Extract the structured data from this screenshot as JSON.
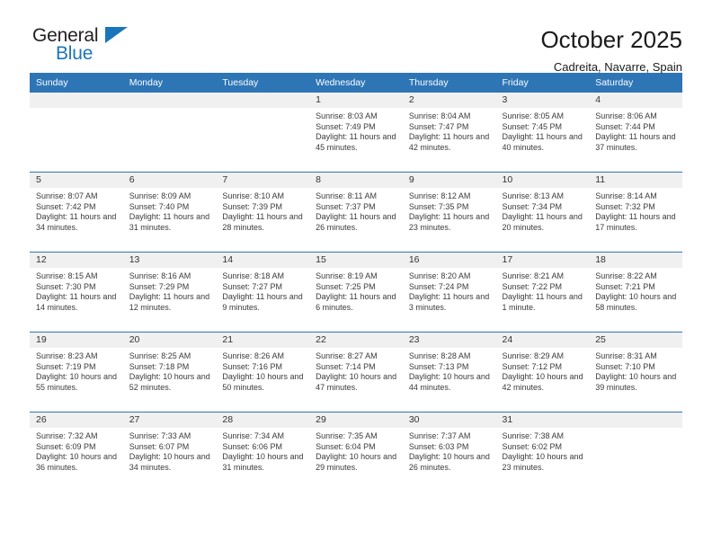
{
  "brand": {
    "name_top": "General",
    "name_bottom": "Blue",
    "accent_color": "#1b75bb",
    "triangle_icon": "triangle-icon"
  },
  "header": {
    "title": "October 2025",
    "subtitle": "Cadreita, Navarre, Spain"
  },
  "calendar": {
    "header_bg": "#2e75b6",
    "daynum_bg": "#f0f0f0",
    "weekdays": [
      "Sunday",
      "Monday",
      "Tuesday",
      "Wednesday",
      "Thursday",
      "Friday",
      "Saturday"
    ],
    "weeks": [
      [
        {
          "day": "",
          "sunrise": "",
          "sunset": "",
          "daylight": "",
          "empty": true
        },
        {
          "day": "",
          "sunrise": "",
          "sunset": "",
          "daylight": "",
          "empty": true
        },
        {
          "day": "",
          "sunrise": "",
          "sunset": "",
          "daylight": "",
          "empty": true
        },
        {
          "day": "1",
          "sunrise": "Sunrise: 8:03 AM",
          "sunset": "Sunset: 7:49 PM",
          "daylight": "Daylight: 11 hours and 45 minutes."
        },
        {
          "day": "2",
          "sunrise": "Sunrise: 8:04 AM",
          "sunset": "Sunset: 7:47 PM",
          "daylight": "Daylight: 11 hours and 42 minutes."
        },
        {
          "day": "3",
          "sunrise": "Sunrise: 8:05 AM",
          "sunset": "Sunset: 7:45 PM",
          "daylight": "Daylight: 11 hours and 40 minutes."
        },
        {
          "day": "4",
          "sunrise": "Sunrise: 8:06 AM",
          "sunset": "Sunset: 7:44 PM",
          "daylight": "Daylight: 11 hours and 37 minutes."
        }
      ],
      [
        {
          "day": "5",
          "sunrise": "Sunrise: 8:07 AM",
          "sunset": "Sunset: 7:42 PM",
          "daylight": "Daylight: 11 hours and 34 minutes."
        },
        {
          "day": "6",
          "sunrise": "Sunrise: 8:09 AM",
          "sunset": "Sunset: 7:40 PM",
          "daylight": "Daylight: 11 hours and 31 minutes."
        },
        {
          "day": "7",
          "sunrise": "Sunrise: 8:10 AM",
          "sunset": "Sunset: 7:39 PM",
          "daylight": "Daylight: 11 hours and 28 minutes."
        },
        {
          "day": "8",
          "sunrise": "Sunrise: 8:11 AM",
          "sunset": "Sunset: 7:37 PM",
          "daylight": "Daylight: 11 hours and 26 minutes."
        },
        {
          "day": "9",
          "sunrise": "Sunrise: 8:12 AM",
          "sunset": "Sunset: 7:35 PM",
          "daylight": "Daylight: 11 hours and 23 minutes."
        },
        {
          "day": "10",
          "sunrise": "Sunrise: 8:13 AM",
          "sunset": "Sunset: 7:34 PM",
          "daylight": "Daylight: 11 hours and 20 minutes."
        },
        {
          "day": "11",
          "sunrise": "Sunrise: 8:14 AM",
          "sunset": "Sunset: 7:32 PM",
          "daylight": "Daylight: 11 hours and 17 minutes."
        }
      ],
      [
        {
          "day": "12",
          "sunrise": "Sunrise: 8:15 AM",
          "sunset": "Sunset: 7:30 PM",
          "daylight": "Daylight: 11 hours and 14 minutes."
        },
        {
          "day": "13",
          "sunrise": "Sunrise: 8:16 AM",
          "sunset": "Sunset: 7:29 PM",
          "daylight": "Daylight: 11 hours and 12 minutes."
        },
        {
          "day": "14",
          "sunrise": "Sunrise: 8:18 AM",
          "sunset": "Sunset: 7:27 PM",
          "daylight": "Daylight: 11 hours and 9 minutes."
        },
        {
          "day": "15",
          "sunrise": "Sunrise: 8:19 AM",
          "sunset": "Sunset: 7:25 PM",
          "daylight": "Daylight: 11 hours and 6 minutes."
        },
        {
          "day": "16",
          "sunrise": "Sunrise: 8:20 AM",
          "sunset": "Sunset: 7:24 PM",
          "daylight": "Daylight: 11 hours and 3 minutes."
        },
        {
          "day": "17",
          "sunrise": "Sunrise: 8:21 AM",
          "sunset": "Sunset: 7:22 PM",
          "daylight": "Daylight: 11 hours and 1 minute."
        },
        {
          "day": "18",
          "sunrise": "Sunrise: 8:22 AM",
          "sunset": "Sunset: 7:21 PM",
          "daylight": "Daylight: 10 hours and 58 minutes."
        }
      ],
      [
        {
          "day": "19",
          "sunrise": "Sunrise: 8:23 AM",
          "sunset": "Sunset: 7:19 PM",
          "daylight": "Daylight: 10 hours and 55 minutes."
        },
        {
          "day": "20",
          "sunrise": "Sunrise: 8:25 AM",
          "sunset": "Sunset: 7:18 PM",
          "daylight": "Daylight: 10 hours and 52 minutes."
        },
        {
          "day": "21",
          "sunrise": "Sunrise: 8:26 AM",
          "sunset": "Sunset: 7:16 PM",
          "daylight": "Daylight: 10 hours and 50 minutes."
        },
        {
          "day": "22",
          "sunrise": "Sunrise: 8:27 AM",
          "sunset": "Sunset: 7:14 PM",
          "daylight": "Daylight: 10 hours and 47 minutes."
        },
        {
          "day": "23",
          "sunrise": "Sunrise: 8:28 AM",
          "sunset": "Sunset: 7:13 PM",
          "daylight": "Daylight: 10 hours and 44 minutes."
        },
        {
          "day": "24",
          "sunrise": "Sunrise: 8:29 AM",
          "sunset": "Sunset: 7:12 PM",
          "daylight": "Daylight: 10 hours and 42 minutes."
        },
        {
          "day": "25",
          "sunrise": "Sunrise: 8:31 AM",
          "sunset": "Sunset: 7:10 PM",
          "daylight": "Daylight: 10 hours and 39 minutes."
        }
      ],
      [
        {
          "day": "26",
          "sunrise": "Sunrise: 7:32 AM",
          "sunset": "Sunset: 6:09 PM",
          "daylight": "Daylight: 10 hours and 36 minutes."
        },
        {
          "day": "27",
          "sunrise": "Sunrise: 7:33 AM",
          "sunset": "Sunset: 6:07 PM",
          "daylight": "Daylight: 10 hours and 34 minutes."
        },
        {
          "day": "28",
          "sunrise": "Sunrise: 7:34 AM",
          "sunset": "Sunset: 6:06 PM",
          "daylight": "Daylight: 10 hours and 31 minutes."
        },
        {
          "day": "29",
          "sunrise": "Sunrise: 7:35 AM",
          "sunset": "Sunset: 6:04 PM",
          "daylight": "Daylight: 10 hours and 29 minutes."
        },
        {
          "day": "30",
          "sunrise": "Sunrise: 7:37 AM",
          "sunset": "Sunset: 6:03 PM",
          "daylight": "Daylight: 10 hours and 26 minutes."
        },
        {
          "day": "31",
          "sunrise": "Sunrise: 7:38 AM",
          "sunset": "Sunset: 6:02 PM",
          "daylight": "Daylight: 10 hours and 23 minutes."
        },
        {
          "day": "",
          "sunrise": "",
          "sunset": "",
          "daylight": "",
          "empty": true
        }
      ]
    ]
  }
}
